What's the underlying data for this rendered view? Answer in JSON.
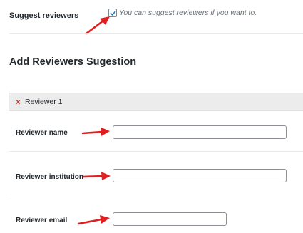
{
  "suggest": {
    "label": "Suggest reviewers",
    "checked": true,
    "hint": "You can suggest reviewers if you want to."
  },
  "section": {
    "title": "Add Reviewers Sugestion"
  },
  "reviewer": {
    "title": "Reviewer 1",
    "remove_icon": "×",
    "fields": {
      "name_label": "Reviewer name",
      "name_value": "",
      "institution_label": "Reviewer institution",
      "institution_value": "",
      "email_label": "Reviewer email",
      "email_value": ""
    }
  },
  "colors": {
    "arrow": "#e02020",
    "remove": "#c0392b",
    "checkbox_check": "#2271b1"
  }
}
